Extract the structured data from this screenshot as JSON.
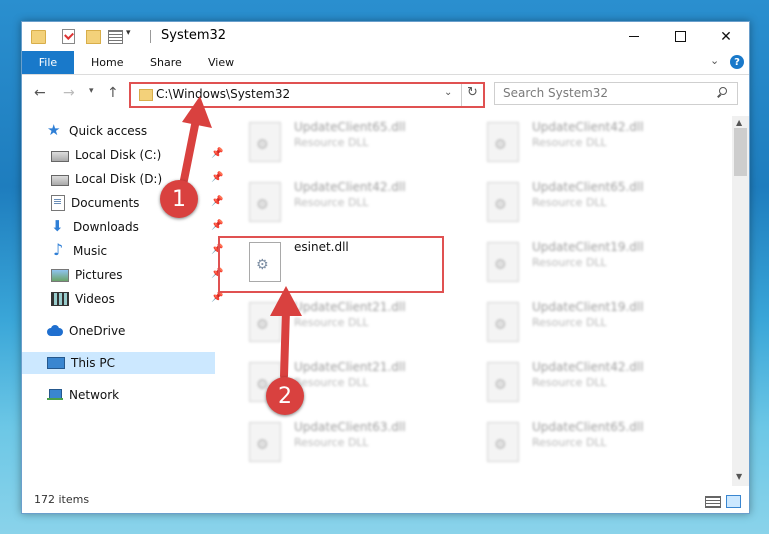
{
  "window": {
    "title": "System32"
  },
  "ribbon": {
    "file": "File",
    "home": "Home",
    "share": "Share",
    "view": "View",
    "help": "?"
  },
  "address": {
    "path": "C:\\Windows\\System32"
  },
  "search": {
    "placeholder": "Search System32"
  },
  "nav_pane": [
    {
      "label": "Quick access",
      "icon": "star-icon"
    },
    {
      "label": "Local Disk (C:)",
      "icon": "disk-icon",
      "pinned": true
    },
    {
      "label": "Local Disk (D:)",
      "icon": "disk-icon",
      "pinned": true
    },
    {
      "label": "Documents",
      "icon": "documents-icon",
      "pinned": true
    },
    {
      "label": "Downloads",
      "icon": "download-icon",
      "pinned": true
    },
    {
      "label": "Music",
      "icon": "music-icon",
      "pinned": true
    },
    {
      "label": "Pictures",
      "icon": "pictures-icon",
      "pinned": true
    },
    {
      "label": "Videos",
      "icon": "videos-icon",
      "pinned": true
    },
    {
      "label": "OneDrive",
      "icon": "cloud-icon"
    },
    {
      "label": "This PC",
      "icon": "computer-icon",
      "selected": true
    },
    {
      "label": "Network",
      "icon": "network-icon"
    }
  ],
  "files": [
    {
      "name": "UpdateClient65.dll",
      "type": "Resource DLL"
    },
    {
      "name": "UpdateClient42.dll",
      "type": "Resource DLL"
    },
    {
      "name": "UpdateClient42.dll",
      "type": "Resource DLL"
    },
    {
      "name": "UpdateClient65.dll",
      "type": "Resource DLL"
    },
    {
      "name": "esinet.dll",
      "type": ""
    },
    {
      "name": "UpdateClient19.dll",
      "type": "Resource DLL"
    },
    {
      "name": "UpdateClient21.dll",
      "type": "Resource DLL"
    },
    {
      "name": "UpdateClient19.dll",
      "type": "Resource DLL"
    },
    {
      "name": "UpdateClient21.dll",
      "type": "Resource DLL"
    },
    {
      "name": "UpdateClient42.dll",
      "type": "Resource DLL"
    },
    {
      "name": "UpdateClient63.dll",
      "type": "Resource DLL"
    },
    {
      "name": "UpdateClient65.dll",
      "type": "Resource DLL"
    }
  ],
  "status": {
    "item_count": "172 items"
  },
  "callouts": {
    "step1": "1",
    "step2": "2"
  },
  "colors": {
    "accent": "#1979ca",
    "highlight": "#e05151",
    "selection": "#cce8ff"
  }
}
